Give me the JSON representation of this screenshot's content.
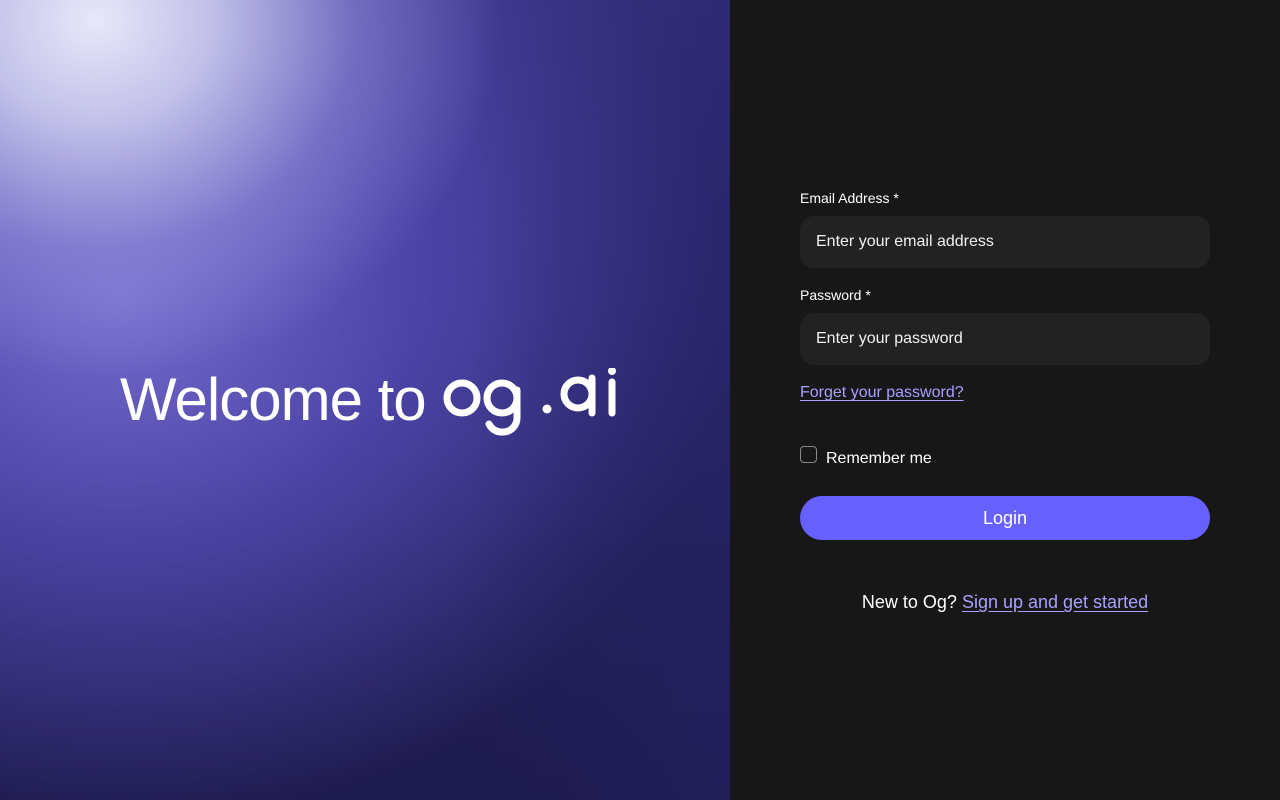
{
  "hero": {
    "welcome_text": "Welcome to",
    "logo_alt": "og.ai"
  },
  "form": {
    "email": {
      "label": "Email Address *",
      "placeholder": "Enter your email address",
      "value": ""
    },
    "password": {
      "label": "Password *",
      "placeholder": "Enter your password",
      "value": ""
    },
    "forgot_password_link": "Forget your password?",
    "remember_me": {
      "label": "Remember me",
      "checked": false
    },
    "login_button": "Login",
    "signup": {
      "prompt": "New to Og?",
      "link": "Sign up and get started"
    }
  },
  "colors": {
    "accent": "#6660ff",
    "link": "#a8a1ff",
    "panel_background": "#171717",
    "input_background": "#222222"
  },
  "icons": {
    "logo": "og-ai-logo",
    "checkbox": "checkbox-unchecked"
  }
}
